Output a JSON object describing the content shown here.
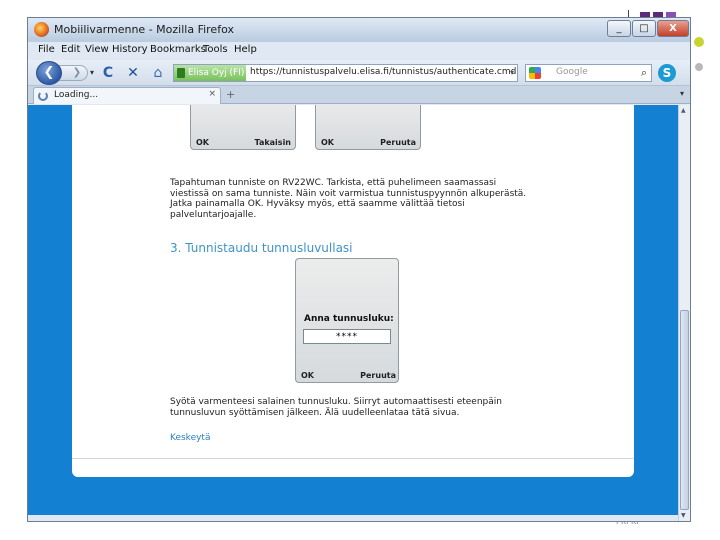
{
  "browser": {
    "window_title": "Mobiilivarmenne - Mozilla Firefox",
    "window_buttons": {
      "minimize": "_",
      "maximize": "□",
      "close": "X"
    },
    "menu": [
      "File",
      "Edit",
      "View",
      "History",
      "Bookmarks",
      "Tools",
      "Help"
    ],
    "site_identity": "Elisa Oyj (FI)",
    "url": "https://tunnistuspalvelu.elisa.fi/tunnistus/authenticate.cmd",
    "search_placeholder": "Google",
    "tab_label": "Loading...",
    "newtab_label": "+",
    "icons": {
      "back": "back-arrow-icon",
      "forward": "forward-arrow-icon",
      "reload": "reload-icon",
      "stop": "stop-icon",
      "home": "home-icon",
      "lock": "lock-icon",
      "search": "magnifier-icon",
      "skype": "skype-icon"
    },
    "glyphs": {
      "back": "❮",
      "forward": "❯",
      "reload": "C",
      "stop": "✕",
      "home": "⌂",
      "search": "⌕",
      "skype": "S",
      "tab_close": "×",
      "dropdown": "▾"
    }
  },
  "page": {
    "phone_top_1": {
      "left": "OK",
      "right": "Takaisin"
    },
    "phone_top_2": {
      "left": "OK",
      "right": "Peruuta"
    },
    "step2_text": [
      "Tapahtuman tunniste on RV22WC. Tarkista, että puhelimeen saamassasi",
      "viestissä on sama tunniste. Näin voit varmistua tunnistuspyynnön alkuperästä.",
      "Jatka painamalla OK. Hyväksy myös, että saamme välittää tietosi",
      "palveluntarjoajalle."
    ],
    "step3_heading": "3. Tunnistaudu tunnusluvullasi",
    "phone_pin": {
      "label": "Anna tunnusluku:",
      "masked_value": "****",
      "left": "OK",
      "right": "Peruuta"
    },
    "step3_text": [
      "Syötä varmenteesi salainen tunnusluku. Siirryt automaattisesti eteenpäin",
      "tunnusluvun syöttämisen jälkeen. Älä uudelleenlataa tätä sivua."
    ],
    "cancel_link": "Keskeytä"
  },
  "slide": {
    "footer_label": "PKI KP",
    "accent_colors": [
      "#5b2b7a",
      "#8a4fb3",
      "#c8d42f",
      "#b9b9b9"
    ]
  }
}
